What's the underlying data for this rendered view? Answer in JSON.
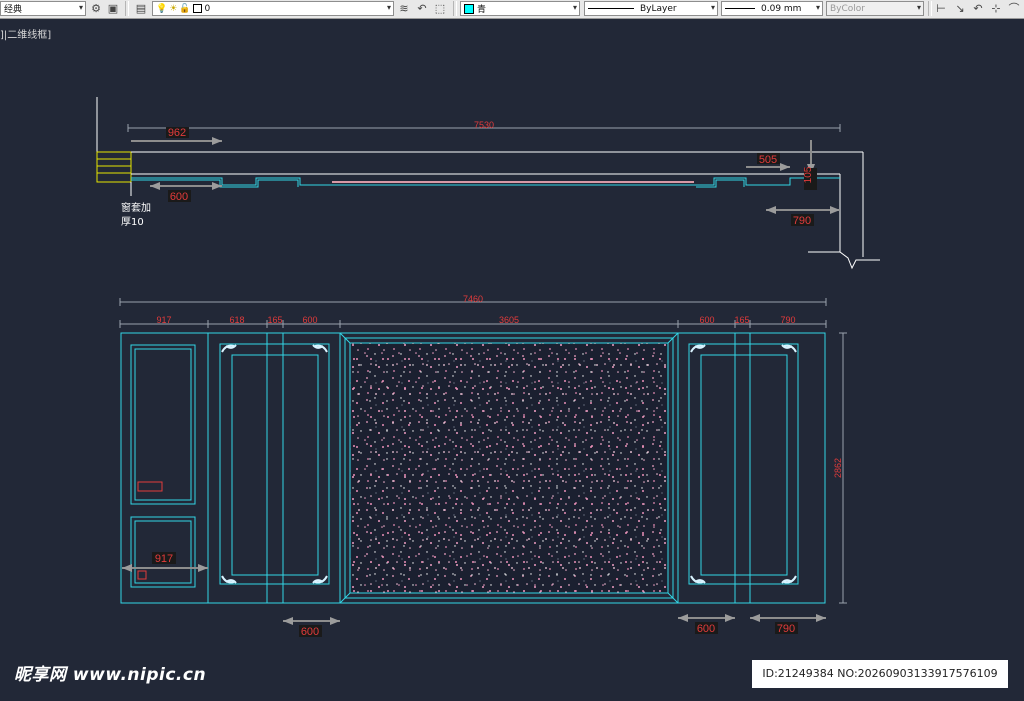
{
  "toolbar": {
    "workspace": "经典",
    "layer": "0",
    "color": "青",
    "linetype": "ByLayer",
    "lineweight": "0.09 mm",
    "plotstyle": "ByColor"
  },
  "viewport_label": "]|二维线框]",
  "plan": {
    "dim_total": "7530",
    "dim_left": "962",
    "dim_600": "600",
    "dim_505": "505",
    "dim_vert": "105",
    "dim_790": "790",
    "note_line1": "窗套加",
    "note_line2": "厚10"
  },
  "elevation": {
    "dim_total": "7460",
    "dims": [
      "917",
      "618",
      "165",
      "600",
      "3605",
      "600",
      "165",
      "790"
    ],
    "height": "2862",
    "inner_917": "917",
    "bottom_600_left": "600",
    "bottom_600_right": "600",
    "bottom_790": "790"
  },
  "watermark": {
    "site": "昵享网 www.nipic.cn",
    "id_text": "ID:21249384 NO:20260903133917576109"
  }
}
